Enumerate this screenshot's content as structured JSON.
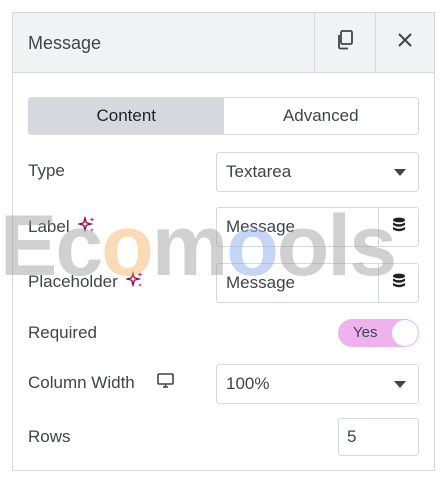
{
  "header": {
    "title": "Message"
  },
  "tabs": [
    {
      "label": "Content",
      "active": true
    },
    {
      "label": "Advanced",
      "active": false
    }
  ],
  "fields": {
    "type": {
      "label": "Type",
      "value": "Textarea"
    },
    "label": {
      "label": "Label",
      "value": "Message"
    },
    "placeholder": {
      "label": "Placeholder",
      "value": "Message"
    },
    "required": {
      "label": "Required",
      "toggle_text": "Yes",
      "on": true
    },
    "column_width": {
      "label": "Column Width",
      "value": "100%"
    },
    "rows": {
      "label": "Rows",
      "value": "5"
    }
  },
  "watermark": {
    "part1": "Ec",
    "o1": "o",
    "part2": "m",
    "o2": "o",
    "part3": "ols"
  },
  "colors": {
    "accent": "#f0b2ee",
    "sparkle": "#93003f",
    "border": "#d5d8dc",
    "header_bg": "#f1f2f3"
  },
  "icons": [
    "copy-icon",
    "close-icon",
    "sparkle-icon",
    "database-icon",
    "desktop-icon",
    "caret-down-icon"
  ]
}
